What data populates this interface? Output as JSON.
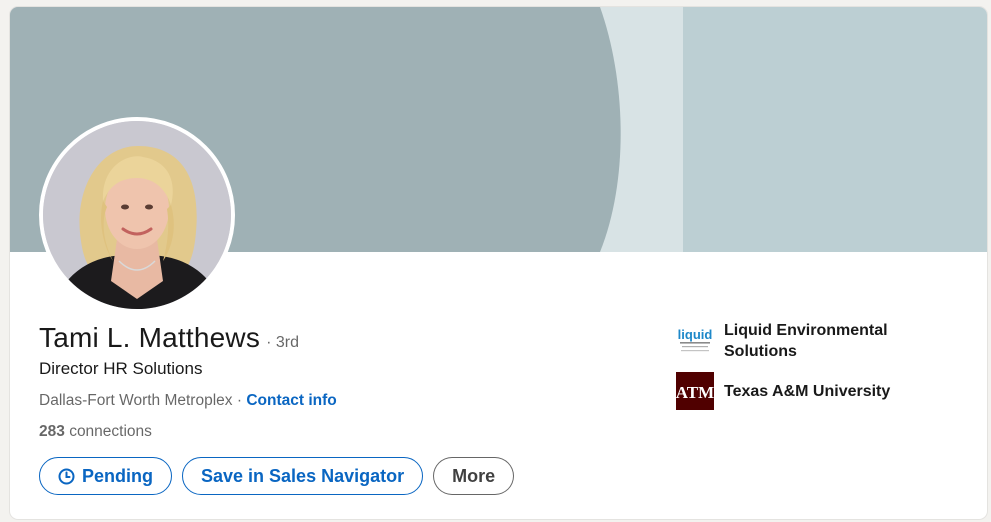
{
  "profile": {
    "name": "Tami L. Matthews",
    "degree": "· 3rd",
    "headline": "Director HR Solutions",
    "location": "Dallas-Fort Worth Metroplex",
    "separator": "·",
    "contact_info_label": "Contact info",
    "connections_count": "283",
    "connections_label": "connections"
  },
  "actions": {
    "pending_label": "Pending",
    "save_label": "Save in Sales Navigator",
    "more_label": "More"
  },
  "orgs": [
    {
      "name": "Liquid Environmental Solutions",
      "logo_text": "liquid",
      "icon": "liquid-environmental-logo"
    },
    {
      "name": "Texas A&M University",
      "logo_text": "ATM",
      "icon": "texas-am-logo"
    }
  ],
  "colors": {
    "accent": "#0a66c2",
    "banner_dark": "#9fb1b5",
    "banner_light": "#d8e3e5",
    "banner_right": "#bccfd3",
    "tamu_maroon": "#500000"
  }
}
